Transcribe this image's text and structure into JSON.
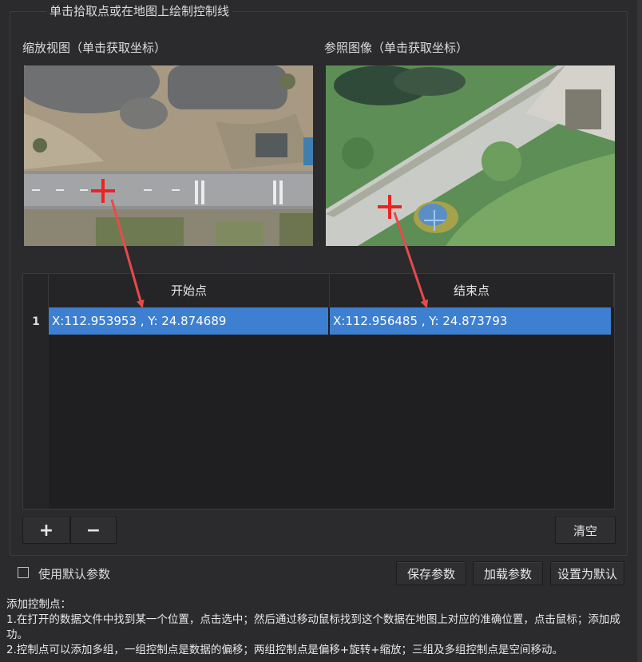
{
  "group": {
    "title": "单击拾取点或在地图上绘制控制线"
  },
  "views": {
    "zoom_label": "缩放视图（单击获取坐标）",
    "reference_label": "参照图像（单击获取坐标）"
  },
  "table": {
    "columns": [
      "开始点",
      "结束点"
    ],
    "rows": [
      {
        "index": "1",
        "start": "X:112.953953 , Y: 24.874689",
        "end": "X:112.956485 , Y: 24.873793"
      }
    ]
  },
  "buttons": {
    "add": "+",
    "remove": "−",
    "clear": "清空",
    "save": "保存参数",
    "load": "加载参数",
    "set_default": "设置为默认"
  },
  "options": {
    "use_default_label": "使用默认参数",
    "use_default_checked": false
  },
  "help": {
    "title": "添加控制点：",
    "line1": "1.在打开的数据文件中找到某一个位置，点击选中；然后通过移动鼠标找到这个数据在地图上对应的准确位置，点击鼠标；添加成功。",
    "line2": "2.控制点可以添加多组，一组控制点是数据的偏移；两组控制点是偏移+旋转+缩放；三组及多组控制点是空间移动。"
  },
  "colors": {
    "selection": "#3d7fd1",
    "marker": "#ee2222",
    "arrow": "#e84a4a"
  }
}
